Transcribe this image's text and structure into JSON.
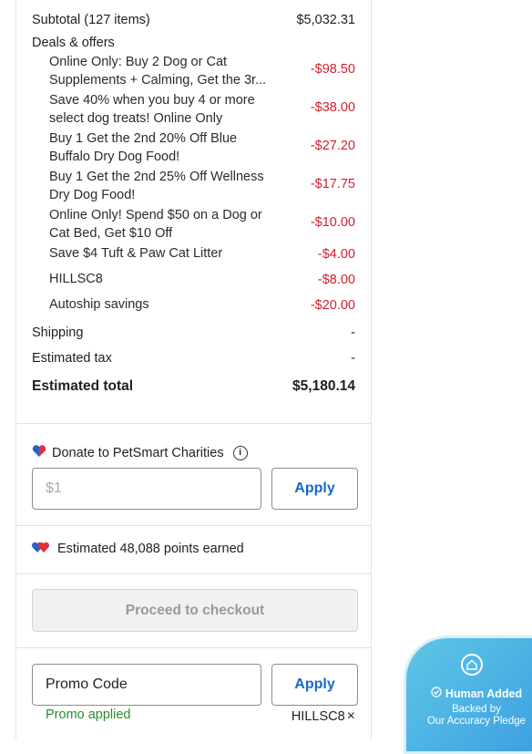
{
  "summary": {
    "subtotal_label": "Subtotal (127 items)",
    "subtotal_value": "$5,032.31",
    "deals_header": "Deals & offers",
    "deals": [
      {
        "text": "Online Only: Buy 2 Dog or Cat Supplements + Calming, Get the 3r...",
        "amount": "-$98.50"
      },
      {
        "text": "Save 40% when you buy 4 or more select dog treats! Online Only",
        "amount": "-$38.00"
      },
      {
        "text": "Buy 1 Get the 2nd 20% Off Blue Buffalo Dry Dog Food!",
        "amount": "-$27.20"
      },
      {
        "text": "Buy 1 Get the 2nd 25% Off Wellness Dry Dog Food!",
        "amount": "-$17.75"
      },
      {
        "text": "Online Only! Spend $50 on a Dog or Cat Bed, Get $10 Off",
        "amount": "-$10.00"
      },
      {
        "text": "Save $4 Tuft & Paw Cat Litter",
        "amount": "-$4.00"
      },
      {
        "text": "HILLSC8",
        "amount": "-$8.00"
      },
      {
        "text": "Autoship savings",
        "amount": "-$20.00"
      }
    ],
    "shipping_label": "Shipping",
    "shipping_value": "-",
    "tax_label": "Estimated tax",
    "tax_value": "-",
    "total_label": "Estimated total",
    "total_value": "$5,180.14"
  },
  "donate": {
    "title": "Donate to PetSmart Charities",
    "info_icon": "i",
    "placeholder": "$1",
    "apply_label": "Apply"
  },
  "points": {
    "text": "Estimated 48,088 points earned"
  },
  "checkout": {
    "label": "Proceed to checkout"
  },
  "promo": {
    "field_value": "Promo Code",
    "apply_label": "Apply",
    "status": "Promo applied",
    "applied_code": "HILLSC8",
    "remove_glyph": "×"
  },
  "badge": {
    "title": "Human Added",
    "line1": "Backed by",
    "line2": "Our Accuracy Pledge"
  },
  "colors": {
    "discount": "#d1202f",
    "link": "#1768c9",
    "success": "#2e8b2e"
  }
}
